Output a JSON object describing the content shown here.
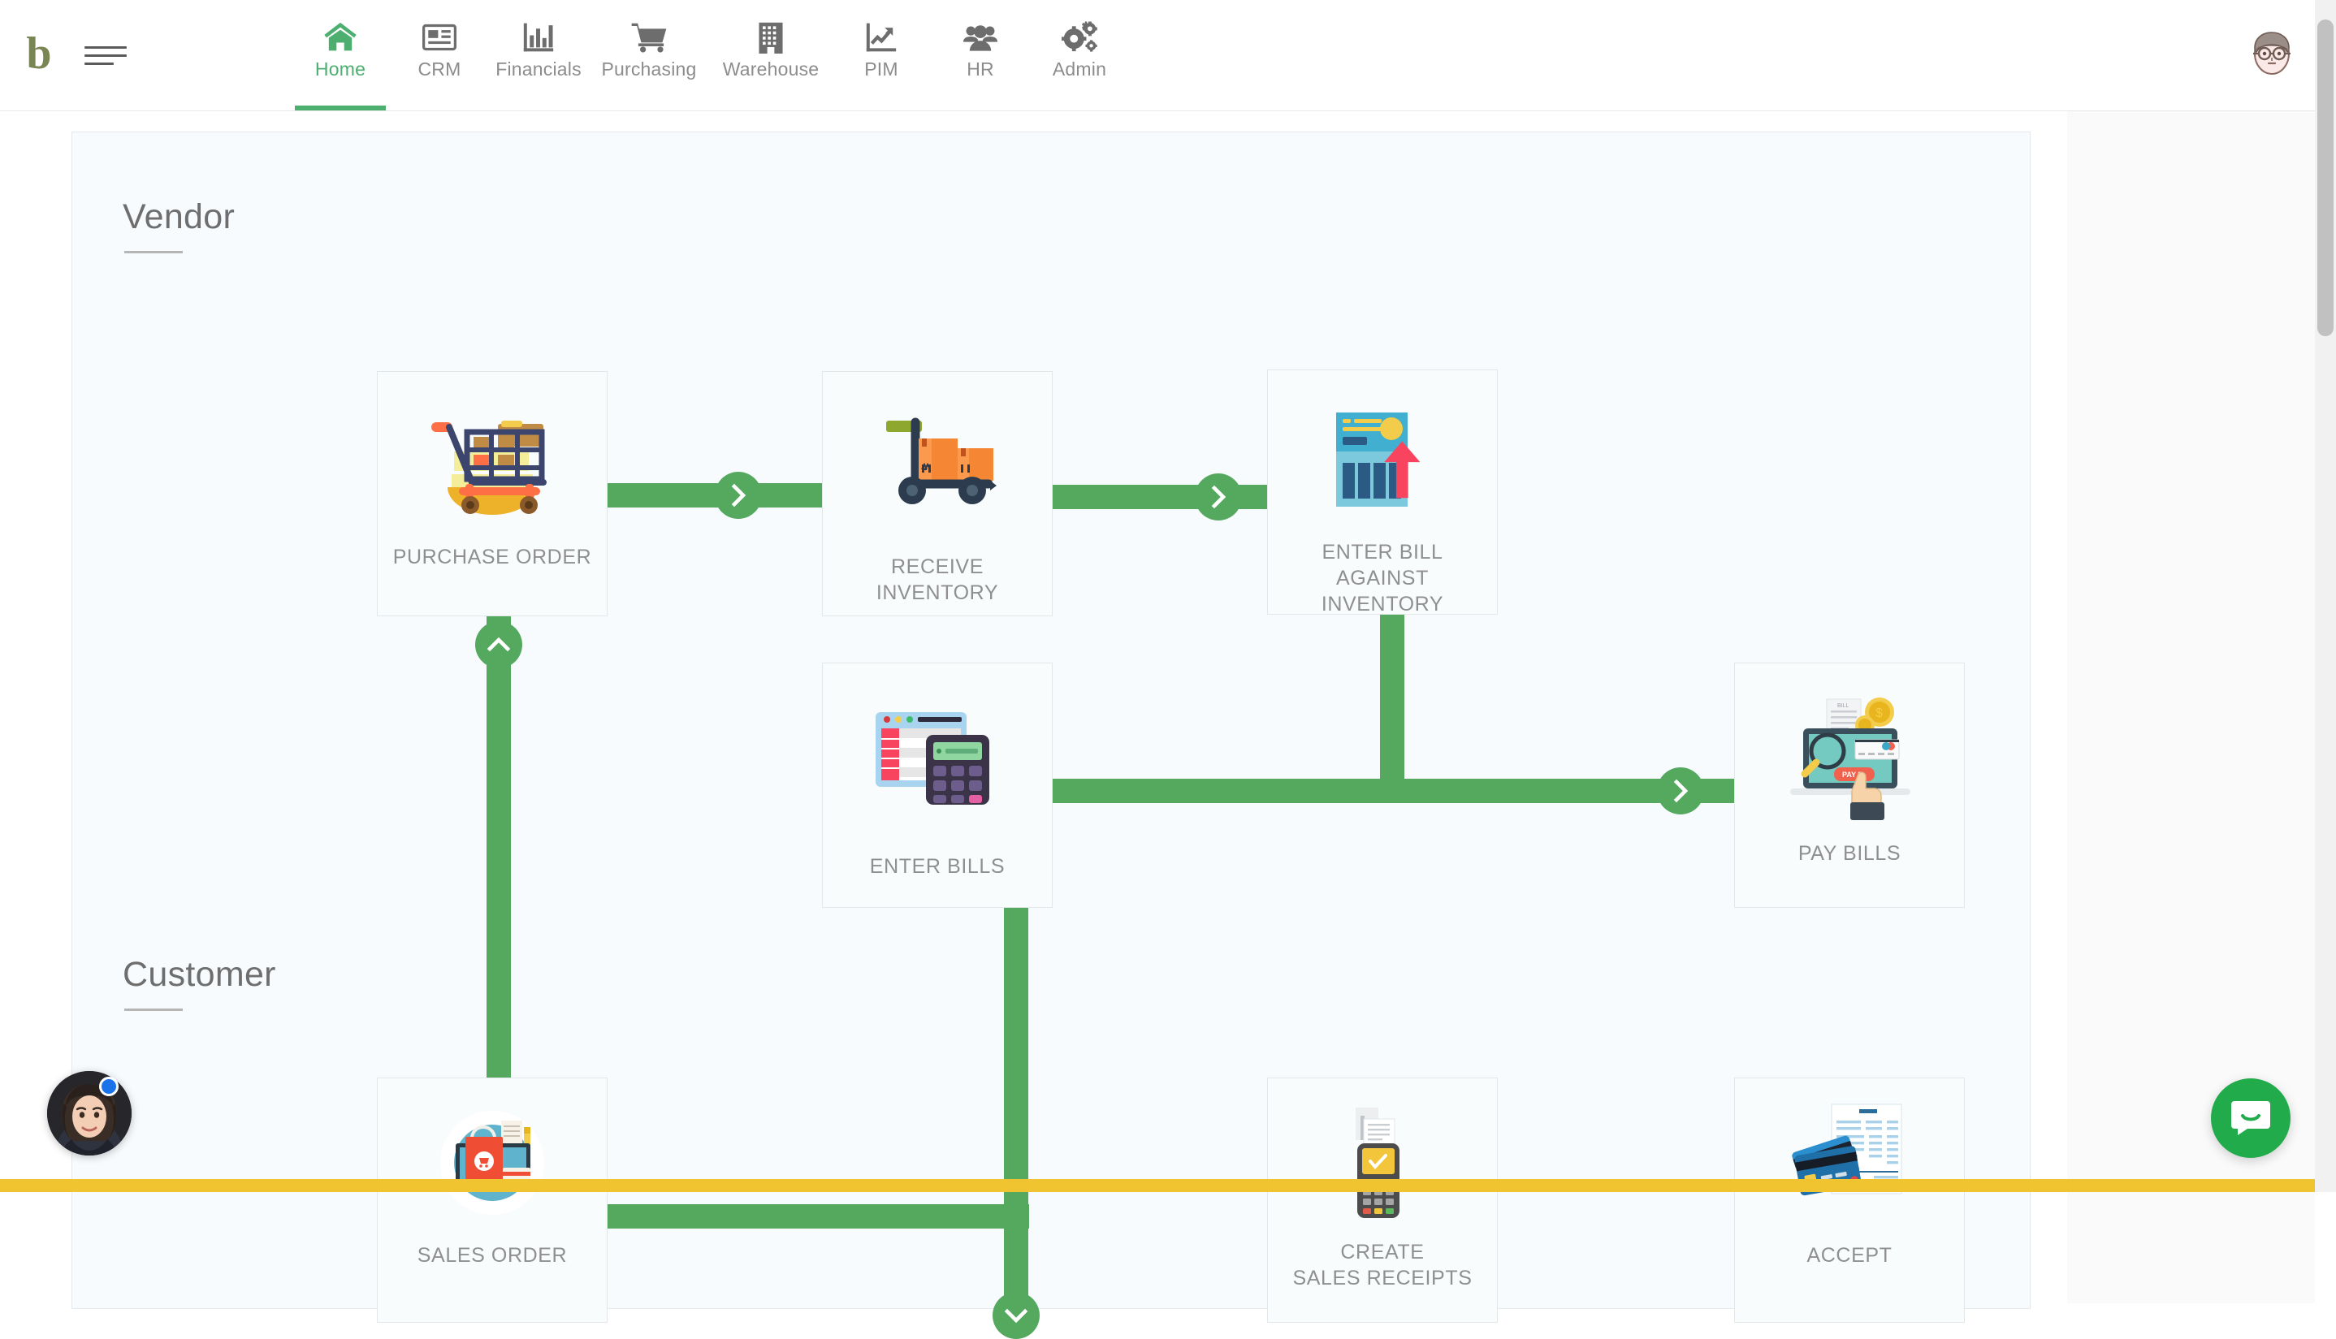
{
  "app": {
    "logo_letter": "b",
    "accent_green": "#4caf70",
    "connector_green": "#55a95f",
    "bottom_bar_color": "#f0c330",
    "chat_color": "#22ab4b"
  },
  "topnav": {
    "menu_icon": "hamburger-icon",
    "avatar_icon": "user-avatar-icon",
    "items": [
      {
        "label": "Home",
        "icon": "home-icon",
        "active": true
      },
      {
        "label": "CRM",
        "icon": "newspaper-icon",
        "active": false
      },
      {
        "label": "Financials",
        "icon": "bar-chart-icon",
        "active": false
      },
      {
        "label": "Purchasing",
        "icon": "shopping-cart-icon",
        "active": false
      },
      {
        "label": "Warehouse",
        "icon": "building-icon",
        "active": false
      },
      {
        "label": "PIM",
        "icon": "line-chart-icon",
        "active": false
      },
      {
        "label": "HR",
        "icon": "users-icon",
        "active": false
      },
      {
        "label": "Admin",
        "icon": "gears-icon",
        "active": false
      }
    ]
  },
  "sections": [
    {
      "title": "Vendor"
    },
    {
      "title": "Customer"
    }
  ],
  "cards": [
    {
      "label": "PURCHASE ORDER",
      "art": "shopping-cart-illustration"
    },
    {
      "label": "RECEIVE INVENTORY",
      "art": "hand-truck-illustration"
    },
    {
      "label": "ENTER BILL\nAGAINST INVENTORY",
      "art": "invoice-arrow-illustration"
    },
    {
      "label": "ENTER BILLS",
      "art": "calculator-spreadsheet-illustration"
    },
    {
      "label": "PAY BILLS",
      "art": "laptop-payment-illustration"
    },
    {
      "label": "SALES ORDER",
      "art": "shopping-bag-laptop-illustration"
    },
    {
      "label": "CREATE\nSALES RECEIPTS",
      "art": "pos-terminal-illustration"
    },
    {
      "label": "ACCEPT",
      "art": "credit-cards-invoice-illustration"
    }
  ],
  "connectors": {
    "arrow_right_icon": "chevron-right-icon",
    "arrow_up_icon": "chevron-up-icon",
    "arrow_down_icon": "chevron-down-icon"
  },
  "support_widget": {
    "agent_avatar": "support-agent-avatar",
    "status": "online"
  },
  "chat_widget": {
    "icon": "chat-bubble-icon"
  }
}
